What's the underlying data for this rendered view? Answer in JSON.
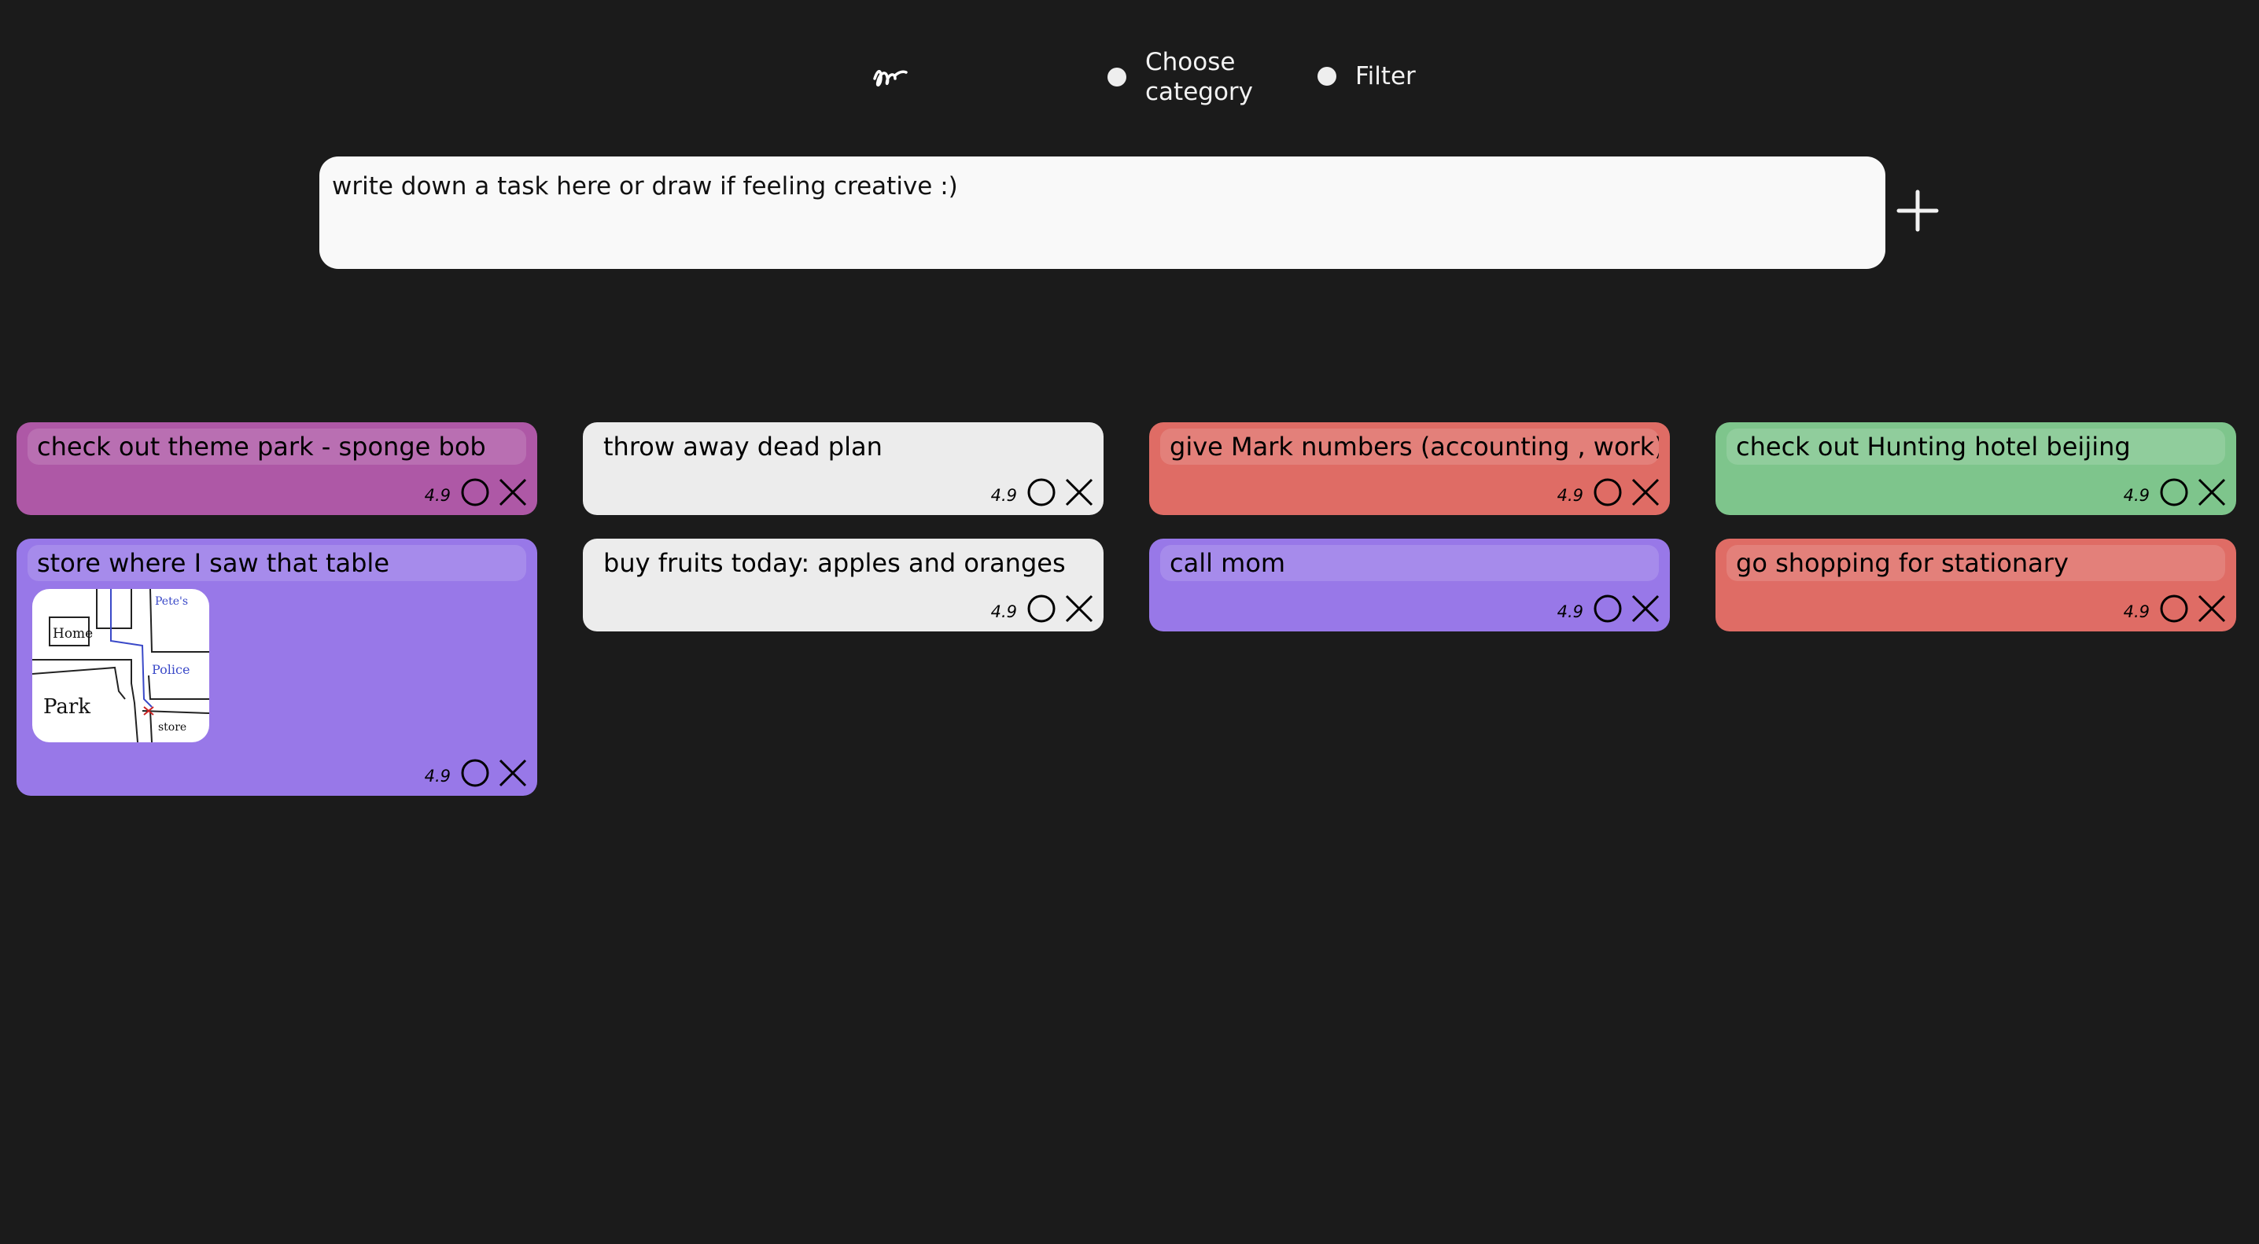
{
  "toolbar": {
    "draw_icon": "scribble-icon",
    "category_label": "Choose\ncategory",
    "filter_label": "Filter"
  },
  "input": {
    "value": "write down a task here or draw if feeling creative :)",
    "add_icon": "plus-icon"
  },
  "colors": {
    "background": "#1b1b1b",
    "magenta": "#ae58a6",
    "white": "#ececec",
    "red": "#df6c65",
    "green": "#7ec58c",
    "purple": "#9878e8"
  },
  "tasks": [
    {
      "title": "check out theme park - sponge bob",
      "score": "4.9",
      "color": "magenta"
    },
    {
      "title": "throw away dead plan",
      "score": "4.9",
      "color": "white"
    },
    {
      "title": "give Mark numbers (accounting , work)",
      "score": "4.9",
      "color": "red"
    },
    {
      "title": "check out Hunting hotel beijing",
      "score": "4.9",
      "color": "green"
    },
    {
      "title": "store where I saw that table",
      "score": "4.9",
      "color": "purple",
      "sketch_labels": [
        "Home",
        "Pete's",
        "Police",
        "Park",
        "store"
      ]
    },
    {
      "title": "buy fruits today: apples and oranges",
      "score": "4.9",
      "color": "white"
    },
    {
      "title": "call mom",
      "score": "4.9",
      "color": "purple"
    },
    {
      "title": "go shopping for stationary",
      "score": "4.9",
      "color": "red"
    }
  ]
}
